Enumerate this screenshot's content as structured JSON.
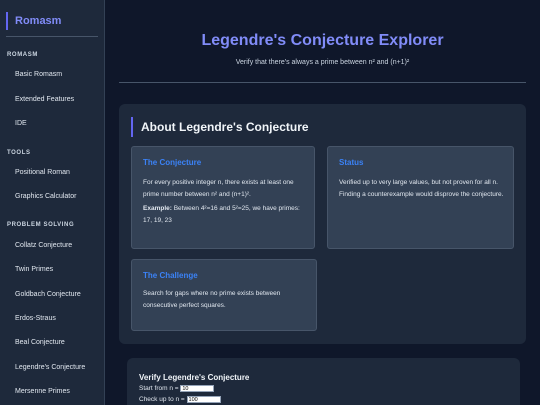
{
  "sidebar": {
    "brand": "Romasm",
    "sections": [
      {
        "title": "ROMASM",
        "items": [
          "Basic Romasm",
          "Extended Features",
          "IDE"
        ]
      },
      {
        "title": "TOOLS",
        "items": [
          "Positional Roman",
          "Graphics Calculator"
        ]
      },
      {
        "title": "PROBLEM SOLVING",
        "items": [
          "Collatz Conjecture",
          "Twin Primes",
          "Goldbach Conjecture",
          "Erdos-Straus",
          "Beal Conjecture",
          "Legendre's Conjecture",
          "Mersenne Primes"
        ]
      }
    ]
  },
  "header": {
    "title": "Legendre's Conjecture Explorer",
    "subtitle": "Verify that there's always a prime between n² and (n+1)²"
  },
  "about": {
    "heading": "About Legendre's Conjecture",
    "cards": [
      {
        "title": "The Conjecture",
        "text": "For every positive integer n, there exists at least one prime number between n² and (n+1)².",
        "example_label": "Example:",
        "example_text": " Between 4²=16 and 5²=25, we have primes: 17, 19, 23"
      },
      {
        "title": "Status",
        "text": "Verified up to very large values, but not proven for all n. Finding a counterexample would disprove the conjecture."
      },
      {
        "title": "The Challenge",
        "text": "Search for gaps where no prime exists between consecutive perfect squares."
      }
    ]
  },
  "verify": {
    "title": "Verify Legendre's Conjecture",
    "start_label": "Start from n =",
    "start_value": "10",
    "end_label": "Check up to n =",
    "end_value": "100"
  },
  "colors": {
    "accent": "#818cf8",
    "card_title": "#3b82f6",
    "background": "#0f172a"
  }
}
